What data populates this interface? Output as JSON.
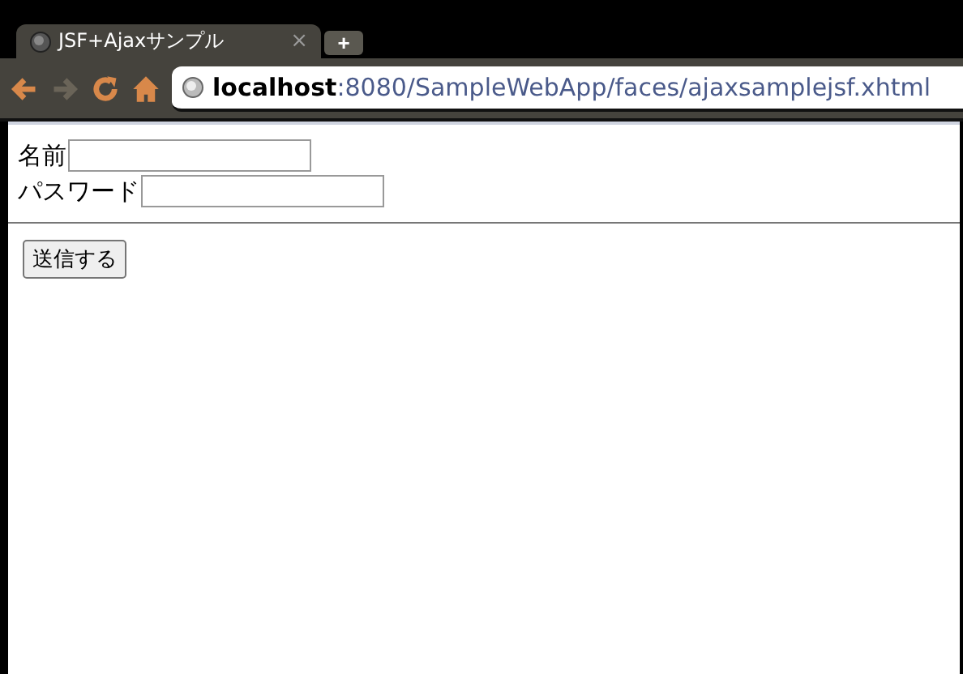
{
  "tabs": [
    {
      "title": "JSF+Ajaxサンプル",
      "close": "×",
      "selected": true
    }
  ],
  "new_tab": "+",
  "address_bar": {
    "url": "**localhost**:8080/SampleWebApp/faces/ajaxsamplejsf.xhtml"
  },
  "form": {
    "fields": [
      {
        "label": "名前"
      },
      {
        "label": "パスワード"
      }
    ],
    "submit": "送信する"
  }
}
